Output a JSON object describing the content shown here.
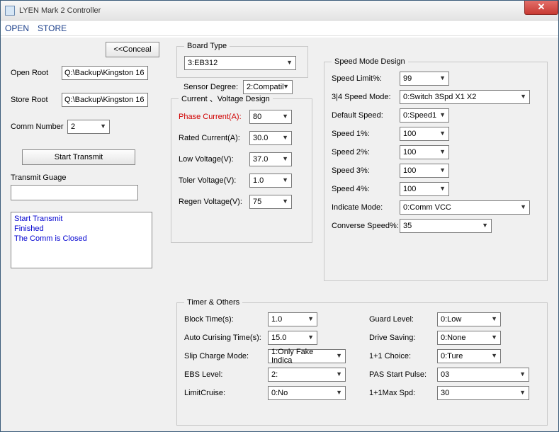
{
  "window": {
    "title": "LYEN Mark 2 Controller"
  },
  "menu": {
    "open": "OPEN",
    "store": "STORE"
  },
  "left": {
    "conceal": "<<Conceal",
    "open_root_lbl": "Open Root",
    "open_root_val": "Q:\\Backup\\Kingston 16",
    "store_root_lbl": "Store Root",
    "store_root_val": "Q:\\Backup\\Kingston 16",
    "comm_lbl": "Comm Number",
    "comm_val": "2",
    "start_transmit": "Start Transmit",
    "transmit_guage": "Transmit Guage",
    "log": "Start Transmit\nFinished\nThe Comm is Closed"
  },
  "board": {
    "legend": "Board Type",
    "value": "3:EB312",
    "sensor_lbl": "Sensor Degree:",
    "sensor_val": "2:Compatil"
  },
  "cv": {
    "legend": "Current 、Voltage Design",
    "phase_lbl": "Phase Current(A):",
    "phase_val": "80",
    "rated_lbl": "Rated Current(A):",
    "rated_val": "30.0",
    "lowv_lbl": "Low Voltage(V):",
    "lowv_val": "37.0",
    "tolv_lbl": "Toler Voltage(V):",
    "tolv_val": "1.0",
    "regen_lbl": "Regen Voltage(V):",
    "regen_val": "75"
  },
  "speed": {
    "legend": "Speed Mode Design",
    "limit_lbl": "Speed Limit%:",
    "limit_val": "99",
    "mode34_lbl": "3|4 Speed Mode:",
    "mode34_val": "0:Switch 3Spd X1 X2",
    "default_lbl": "Default Speed:",
    "default_val": "0:Speed1",
    "s1_lbl": "Speed 1%:",
    "s1_val": "100",
    "s2_lbl": "Speed 2%:",
    "s2_val": "100",
    "s3_lbl": "Speed 3%:",
    "s3_val": "100",
    "s4_lbl": "Speed 4%:",
    "s4_val": "100",
    "indicate_lbl": "Indicate Mode:",
    "indicate_val": "0:Comm VCC",
    "conv_lbl": "Converse Speed%:",
    "conv_val": "35"
  },
  "timer": {
    "legend": "Timer & Others",
    "block_lbl": "Block Time(s):",
    "block_val": "1.0",
    "auto_lbl": "Auto Curising Time(s):",
    "auto_val": "15.0",
    "slip_lbl": "Slip Charge Mode:",
    "slip_val": "1:Only Fake Indica",
    "ebs_lbl": "EBS Level:",
    "ebs_val": "2:",
    "limitcruise_lbl": "LimitCruise:",
    "limitcruise_val": "0:No",
    "guard_lbl": "Guard Level:",
    "guard_val": "0:Low",
    "drive_lbl": "Drive Saving:",
    "drive_val": "0:None",
    "choice_lbl": "1+1 Choice:",
    "choice_val": "0:Ture",
    "pas_lbl": "PAS Start Pulse:",
    "pas_val": "03",
    "maxspd_lbl": "1+1Max Spd:",
    "maxspd_val": "30"
  }
}
